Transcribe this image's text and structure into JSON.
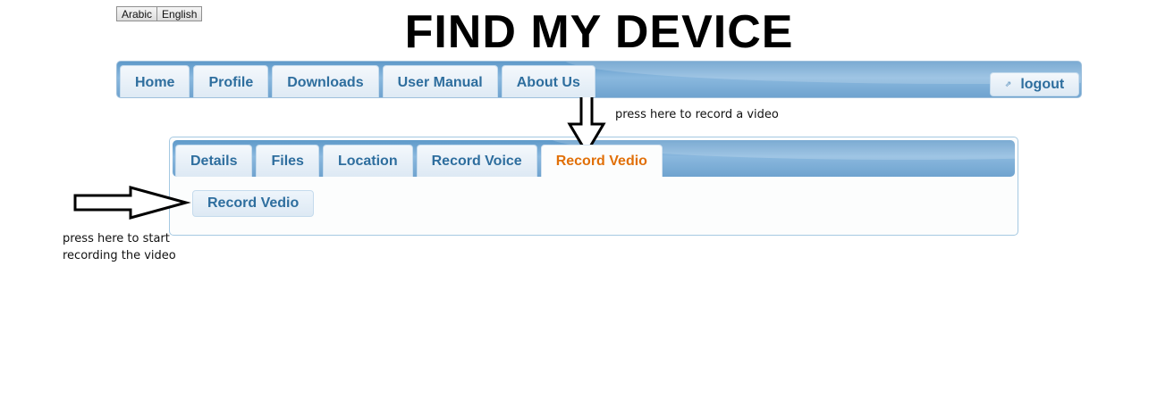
{
  "language_switch": {
    "arabic_label": "Arabic",
    "english_label": "English"
  },
  "page_title": "FIND MY DEVICE",
  "nav": {
    "tabs": [
      {
        "label": "Home"
      },
      {
        "label": "Profile"
      },
      {
        "label": "Downloads"
      },
      {
        "label": "User Manual"
      },
      {
        "label": "About Us"
      }
    ],
    "logout_label": "logout"
  },
  "panel": {
    "tabs": [
      {
        "label": "Details",
        "active": false
      },
      {
        "label": "Files",
        "active": false
      },
      {
        "label": "Location",
        "active": false
      },
      {
        "label": "Record Voice",
        "active": false
      },
      {
        "label": "Record Vedio",
        "active": true
      }
    ],
    "action_button_label": "Record Vedio"
  },
  "annotations": {
    "top_note": "press here to record a video",
    "left_note": "press here to start recording the video"
  },
  "colors": {
    "tab_text": "#2e6e9e",
    "active_tab_text": "#e17009",
    "bar_blue": "#6fa3cf"
  }
}
